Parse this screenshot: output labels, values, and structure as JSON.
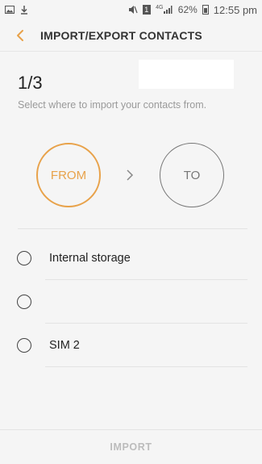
{
  "status_bar": {
    "battery_percent": "62%",
    "time": "12:55 pm",
    "sim_badge": "1",
    "network_type": "4G"
  },
  "header": {
    "title": "IMPORT/EXPORT CONTACTS"
  },
  "wizard": {
    "step": "1/3",
    "instruction": "Select where to import your contacts from.",
    "from_label": "FROM",
    "to_label": "TO"
  },
  "options": [
    {
      "label": "Internal storage"
    },
    {
      "label": ""
    },
    {
      "label": "SIM 2"
    }
  ],
  "footer": {
    "import_label": "IMPORT"
  },
  "colors": {
    "accent": "#e8a24a",
    "text_primary": "#222222",
    "text_secondary": "#9a9a9a",
    "disabled": "#bcbcbc"
  }
}
